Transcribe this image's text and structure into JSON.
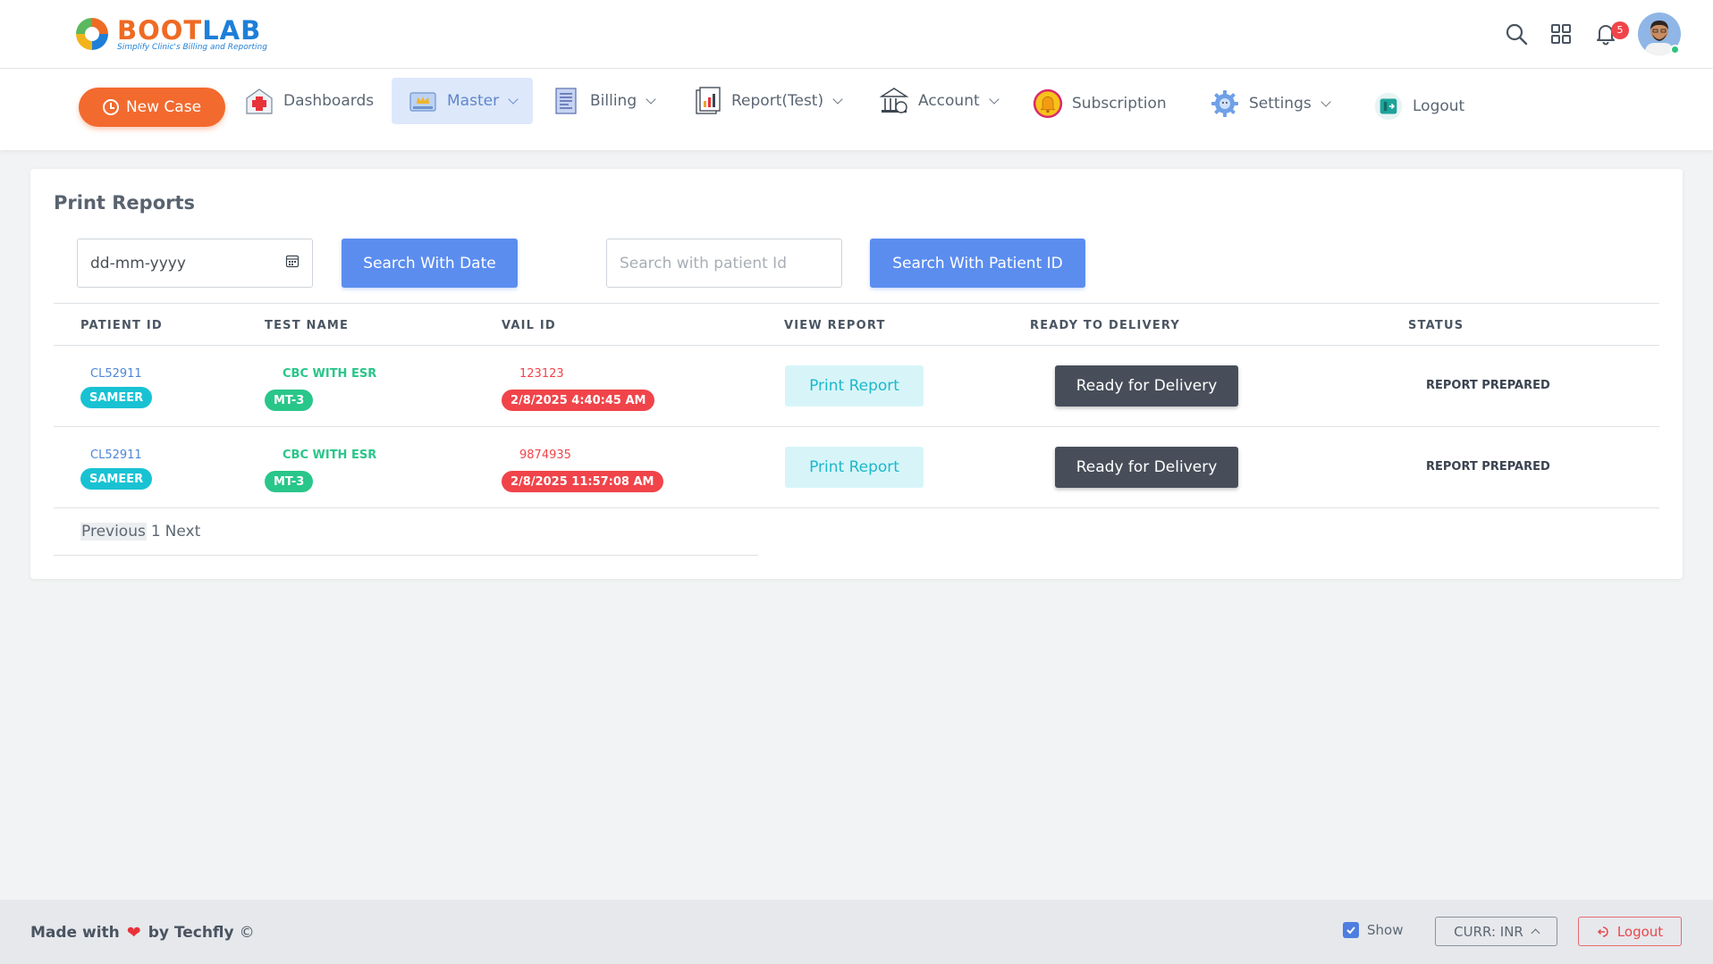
{
  "header": {
    "logo_title_a": "BOOT",
    "logo_title_b": "LAB",
    "logo_tagline": "Simplify Clinic's Billing and Reporting",
    "notification_count": "5"
  },
  "nav": {
    "new_case": "New Case",
    "items": [
      {
        "label": "Dashboards",
        "icon": "hospital-icon"
      },
      {
        "label": "Master",
        "icon": "crown-board-icon",
        "active": true
      },
      {
        "label": "Billing",
        "icon": "invoice-icon"
      },
      {
        "label": "Report(Test)",
        "icon": "report-chart-icon"
      },
      {
        "label": "Account",
        "icon": "bank-icon"
      },
      {
        "label": "Subscription",
        "icon": "bell-badge-icon"
      },
      {
        "label": "Settings",
        "icon": "gear-icon"
      },
      {
        "label": "Logout",
        "icon": "logout-icon"
      }
    ]
  },
  "page": {
    "title": "Print Reports",
    "date_placeholder": "dd-mm-yyyy",
    "search_date_button": "Search With Date",
    "patient_placeholder": "Search with patient Id",
    "search_patient_button": "Search With Patient ID"
  },
  "table": {
    "headers": [
      "PATIENT ID",
      "TEST NAME",
      "VAIL ID",
      "VIEW REPORT",
      "READY TO DELIVERY",
      "STATUS"
    ],
    "rows": [
      {
        "patient_id": "CL52911",
        "patient_name": "SAMEER",
        "test_name": "CBC WITH ESR",
        "test_code": "MT-3",
        "vail_id": "123123",
        "datetime": "2/8/2025 4:40:45 AM",
        "view_report": "Print Report",
        "ready": "Ready for Delivery",
        "status": "REPORT PREPARED"
      },
      {
        "patient_id": "CL52911",
        "patient_name": "SAMEER",
        "test_name": "CBC WITH ESR",
        "test_code": "MT-3",
        "vail_id": "9874935",
        "datetime": "2/8/2025 11:57:08 AM",
        "view_report": "Print Report",
        "ready": "Ready for Delivery",
        "status": "REPORT PREPARED"
      }
    ]
  },
  "pagination": {
    "previous": "Previous",
    "page": "1",
    "next": "Next"
  },
  "footer": {
    "made_with": "Made with",
    "by": "by Techfly",
    "copyright": "©",
    "show_label": "Show",
    "currency": "CURR: INR",
    "logout": "Logout"
  },
  "colors": {
    "accent_orange": "#f26a2e",
    "primary_blue": "#5b8def",
    "dark_button": "#474e5a",
    "danger": "#f0444a",
    "success": "#29c68a",
    "info": "#19c2d3"
  }
}
